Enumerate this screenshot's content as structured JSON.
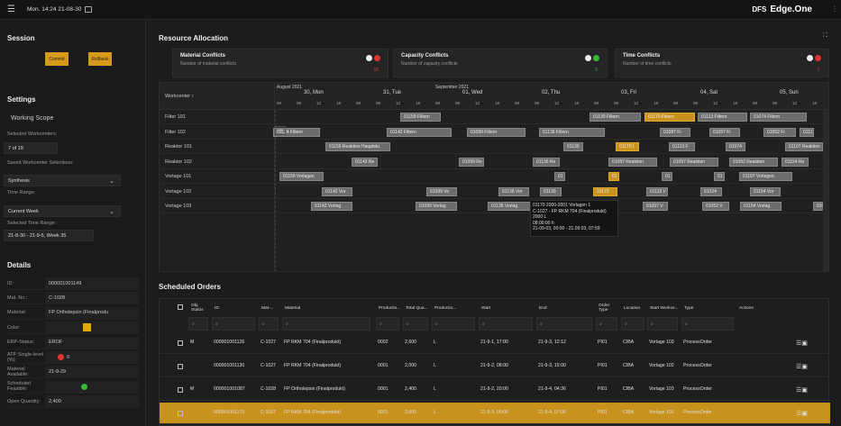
{
  "topbar": {
    "datetime": "Mon. 14:24 21-08-30",
    "brand_prefix": "DFS",
    "brand": "Edge.One"
  },
  "session": {
    "title": "Session",
    "commit_label": "Commit",
    "rollback_label": "Rollback"
  },
  "settings": {
    "title": "Settings",
    "scope_title": "Working Scope",
    "selected_workcenters_label": "Selected Workcenters:",
    "selected_workcenters_value": "7 of 19",
    "saved_selections_label": "Saved Workcenter Selections:",
    "saved_selection": "Synthesis",
    "time_range_label": "Time Range:",
    "time_range": "Current Week",
    "selected_time_range_label": "Selected Time Range:",
    "selected_time_range": "21-8-30 - 21-9-5, Week 35"
  },
  "details": {
    "title": "Details",
    "rows": [
      {
        "k": "ID:",
        "v": "000001001149"
      },
      {
        "k": "Mat. No.:",
        "v": "C-1028"
      },
      {
        "k": "Material:",
        "v": "FP Ortholepsin (Finalprodu"
      },
      {
        "k": "Color:",
        "v": ""
      },
      {
        "k": "ERP-Status:",
        "v": "EROF"
      },
      {
        "k": "ATP Single-level (%):",
        "v": "0"
      },
      {
        "k": "Material Available:",
        "v": "21-9-29"
      },
      {
        "k": "Scheduled Feasible:",
        "v": ""
      },
      {
        "k": "Open Quantity:",
        "v": "2,400"
      }
    ],
    "color_value": "#e3a51d"
  },
  "resource_allocation": {
    "title": "Resource Allocation",
    "cards": [
      {
        "title": "Material Conflicts",
        "sub": "Number of material conflicts",
        "count": "16",
        "status": "red"
      },
      {
        "title": "Capacity Conflicts",
        "sub": "Number of capacity conflicts",
        "count": "0",
        "status": "green"
      },
      {
        "title": "Time Conflicts",
        "sub": "Number of time conflicts",
        "count": "7",
        "status": "red"
      }
    ],
    "workcenter_header": "Workcenter",
    "months": [
      "August 2021",
      "September 2021"
    ],
    "days": [
      "30, Mon",
      "31, Tue",
      "01, Wed",
      "02, Thu",
      "03, Fri",
      "04, Sat",
      "05, Sun"
    ],
    "hours": [
      "00",
      "06",
      "12",
      "18"
    ],
    "workcenters": [
      "Filter 101",
      "Filter 102",
      "Reaktor 101",
      "Reaktor 102",
      "Vorlage 101",
      "Vorlage 102",
      "Vorlage 103"
    ],
    "bars": [
      [
        {
          "l": "01159 Filtern",
          "s": 443,
          "e": 488
        },
        {
          "l": "01130 Filtern",
          "s": 653,
          "e": 710
        },
        {
          "l": "01170 Filtern",
          "s": 714,
          "e": 770,
          "y": true
        },
        {
          "l": "01113 Filtern",
          "s": 773,
          "e": 828
        },
        {
          "l": "01074 Filtern",
          "s": 831,
          "e": 894
        }
      ],
      [
        {
          "l": "01124 Filtern",
          "s": 302,
          "e": 354
        },
        {
          "l": "01142 Filtern",
          "s": 428,
          "e": 500
        },
        {
          "l": "01099 Filtern",
          "s": 517,
          "e": 582
        },
        {
          "l": "01136 Filtern",
          "s": 597,
          "e": 670
        },
        {
          "l": "01087 Fi",
          "s": 731,
          "e": 765
        },
        {
          "l": "01057 Fi",
          "s": 786,
          "e": 820
        },
        {
          "l": "01052 Fi",
          "s": 846,
          "e": 882
        },
        {
          "l": "0111",
          "s": 886,
          "e": 902
        }
      ],
      [
        {
          "l": "01159 Reaktion Hauptstu",
          "s": 360,
          "e": 432
        },
        {
          "l": "01130",
          "s": 624,
          "e": 646
        },
        {
          "l": "01170 I",
          "s": 682,
          "e": 708,
          "y": true
        },
        {
          "l": "01113 F",
          "s": 741,
          "e": 770
        },
        {
          "l": "01074",
          "s": 804,
          "e": 826
        },
        {
          "l": "01107 Reaktion",
          "s": 870,
          "e": 912
        }
      ],
      [
        {
          "l": "01142 Re",
          "s": 389,
          "e": 418
        },
        {
          "l": "01099 Re",
          "s": 508,
          "e": 536
        },
        {
          "l": "01136 Re",
          "s": 590,
          "e": 620
        },
        {
          "l": "01087 Reaktion",
          "s": 674,
          "e": 728
        },
        {
          "l": "01057 Reaktion",
          "s": 742,
          "e": 796
        },
        {
          "l": "01052 Reaktion",
          "s": 808,
          "e": 862
        },
        {
          "l": "01154 Re",
          "s": 866,
          "e": 896
        }
      ],
      [
        {
          "l": "01159 Vorlagen",
          "s": 309,
          "e": 358
        },
        {
          "l": "01",
          "s": 614,
          "e": 626
        },
        {
          "l": "01",
          "s": 674,
          "e": 686,
          "y": true
        },
        {
          "l": "01",
          "s": 733,
          "e": 745
        },
        {
          "l": "01",
          "s": 791,
          "e": 803
        },
        {
          "l": "01107 Vorlagen",
          "s": 819,
          "e": 878
        }
      ],
      [
        {
          "l": "01142 Vor",
          "s": 356,
          "e": 390
        },
        {
          "l": "01099 Vo",
          "s": 472,
          "e": 506
        },
        {
          "l": "01136 Vor",
          "s": 552,
          "e": 586
        },
        {
          "l": "01130",
          "s": 598,
          "e": 622
        },
        {
          "l": "01170",
          "s": 657,
          "e": 684,
          "y": true
        },
        {
          "l": "01113 V",
          "s": 716,
          "e": 740
        },
        {
          "l": "01024",
          "s": 776,
          "e": 800
        },
        {
          "l": "01154 Vor",
          "s": 831,
          "e": 865
        }
      ],
      [
        {
          "l": "01142 Vorlag",
          "s": 344,
          "e": 390
        },
        {
          "l": "01099 Vorlag",
          "s": 460,
          "e": 506
        },
        {
          "l": "01136 Vorlag",
          "s": 540,
          "e": 590
        },
        {
          "l": "01057 V",
          "s": 712,
          "e": 740
        },
        {
          "l": "01052 V",
          "s": 778,
          "e": 808
        },
        {
          "l": "01154 Vorlag",
          "s": 820,
          "e": 866
        },
        {
          "l": "010",
          "s": 901,
          "e": 914
        }
      ]
    ],
    "tooltip": [
      "01170 2000-2001 Vorlagen 1",
      "C-1027 - FP RKM 704 (Finalprodukt)",
      "2000 L",
      "08:00:00 h",
      "21-09-03, 00:00 - 21.09.03, 07:59"
    ]
  },
  "orders": {
    "title": "Scheduled Orders",
    "headers": [
      "Obj Status",
      "ID",
      "Mat-...",
      "Material",
      "Productio...",
      "Total Qua...",
      "Productio...",
      "Start",
      "End",
      "Order Type",
      "Location",
      "Start Workce...",
      "Type",
      "Actions"
    ],
    "rows": [
      [
        "M",
        "000001001126",
        "C-1027",
        "FP RKM 704 (Finalprodukt)",
        "0002",
        "2,600",
        "L",
        "21-9-1, 17:00",
        "21-9-3, 12:12",
        "PI01",
        "CIBA",
        "Vorlage 103",
        "ProcessOrder"
      ],
      [
        "",
        "000001001130",
        "C-1027",
        "FP RKM 704 (Finalprodukt)",
        "0001",
        "2,000",
        "L",
        "21-9-2, 08:00",
        "21-9-3, 15:00",
        "PI01",
        "CIBA",
        "Vorlage 102",
        "ProcessOrder"
      ],
      [
        "M",
        "000001001087",
        "C-1028",
        "FP Ortholepsin (Finalprodukt)",
        "0001",
        "2,400",
        "L",
        "21-9-2, 20:00",
        "21-9-4, 04:36",
        "PI01",
        "CIBA",
        "Vorlage 103",
        "ProcessOrder"
      ],
      [
        "",
        "000001001170",
        "C-1027",
        "FP RKM 704 (Finalprodukt)",
        "0001",
        "2,000",
        "L",
        "21-9-3, 00:00",
        "21-9-4, 07:00",
        "PI01",
        "CIBA",
        "Vorlage 101",
        "ProcessOrder"
      ]
    ],
    "selected_row": 3
  }
}
